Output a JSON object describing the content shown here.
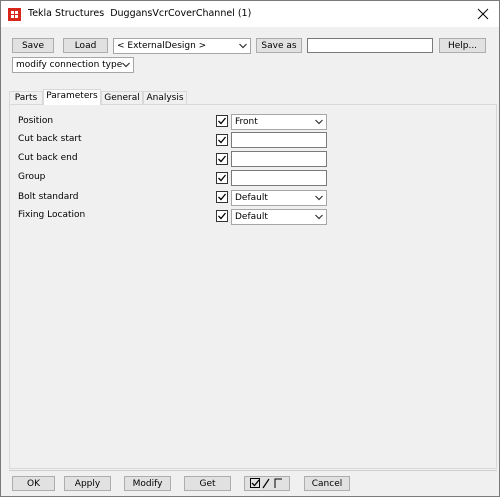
{
  "window": {
    "title": "Tekla Structures  DuggansVcrCoverChannel (1)"
  },
  "toolbar": {
    "save_label": "Save",
    "load_label": "Load",
    "preset_value": "< ExternalDesign >",
    "saveas_label": "Save as",
    "saveas_value": "",
    "help_label": "Help...",
    "mode_value": "modify connection type"
  },
  "tabs": [
    {
      "label": "Parts"
    },
    {
      "label": "Parameters"
    },
    {
      "label": "General"
    },
    {
      "label": "Analysis"
    }
  ],
  "parameters": {
    "position": {
      "label": "Position",
      "value": "Front",
      "checked": true
    },
    "cut_back_start": {
      "label": "Cut back start",
      "value": "",
      "checked": true
    },
    "cut_back_end": {
      "label": "Cut back end",
      "value": "",
      "checked": true
    },
    "group": {
      "label": "Group",
      "value": "",
      "checked": true
    },
    "bolt_standard": {
      "label": "Bolt standard",
      "value": "Default",
      "checked": true
    },
    "fixing_location": {
      "label": "Fixing Location",
      "value": "Default",
      "checked": true
    }
  },
  "footer": {
    "ok_label": "OK",
    "apply_label": "Apply",
    "modify_label": "Modify",
    "get_label": "Get",
    "cancel_label": "Cancel"
  },
  "icons": {
    "app": "tekla-app-icon",
    "close": "close-icon",
    "dropdown": "chevron-down-icon",
    "checkbox": "checkbox-checked-icon",
    "toggle": "check-toggle-icon"
  },
  "colors": {
    "window_bg": "#f0f0f0",
    "titlebar_bg": "#ffffff",
    "app_icon_red": "#d9261c"
  }
}
